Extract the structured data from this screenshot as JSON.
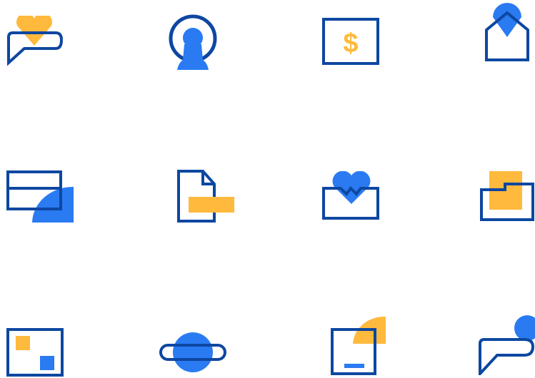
{
  "colors": {
    "navy": "#0d47a1",
    "blue": "#2a7bf2",
    "yellow": "#ffb93c",
    "background": "#ffffff"
  },
  "icons": [
    "heart-chat-icon",
    "user-avatar-icon",
    "dollar-bill-icon",
    "home-location-icon",
    "card-pie-icon",
    "document-edit-icon",
    "heartbeat-mail-icon",
    "folder-stack-icon",
    "gallery-icon",
    "planet-icon",
    "box-pie-icon",
    "chat-dot-icon"
  ]
}
